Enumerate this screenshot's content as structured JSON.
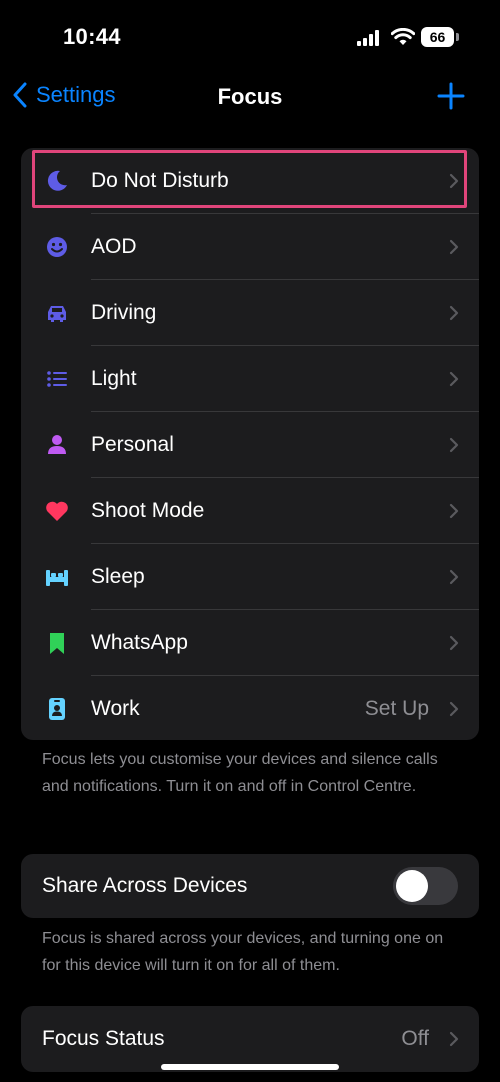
{
  "status_bar": {
    "time": "10:44",
    "battery": "66"
  },
  "nav": {
    "back_label": "Settings",
    "title": "Focus"
  },
  "focus_modes": [
    {
      "label": "Do Not Disturb",
      "value": "",
      "icon": "moon-icon",
      "color": "#5e5ce6"
    },
    {
      "label": "AOD",
      "value": "",
      "icon": "smiley-icon",
      "color": "#5e5ce6"
    },
    {
      "label": "Driving",
      "value": "",
      "icon": "car-icon",
      "color": "#5e5ce6"
    },
    {
      "label": "Light",
      "value": "",
      "icon": "list-icon",
      "color": "#5e5ce6"
    },
    {
      "label": "Personal",
      "value": "",
      "icon": "person-icon",
      "color": "#bf5af2"
    },
    {
      "label": "Shoot Mode",
      "value": "",
      "icon": "heart-icon",
      "color": "#ff375f"
    },
    {
      "label": "Sleep",
      "value": "",
      "icon": "bed-icon",
      "color": "#64d2ff"
    },
    {
      "label": "WhatsApp",
      "value": "",
      "icon": "bookmark-icon",
      "color": "#30d158"
    },
    {
      "label": "Work",
      "value": "Set Up",
      "icon": "badge-icon",
      "color": "#64d2ff"
    }
  ],
  "focus_footnote": "Focus lets you customise your devices and silence calls and notifications. Turn it on and off in Control Centre.",
  "share": {
    "label": "Share Across Devices",
    "enabled": false,
    "footnote": "Focus is shared across your devices, and turning one on for this device will turn it on for all of them."
  },
  "focus_status": {
    "label": "Focus Status",
    "value": "Off"
  },
  "colors": {
    "accent": "#0a84ff",
    "highlight": "#e0457b",
    "card": "#1c1c1e"
  }
}
